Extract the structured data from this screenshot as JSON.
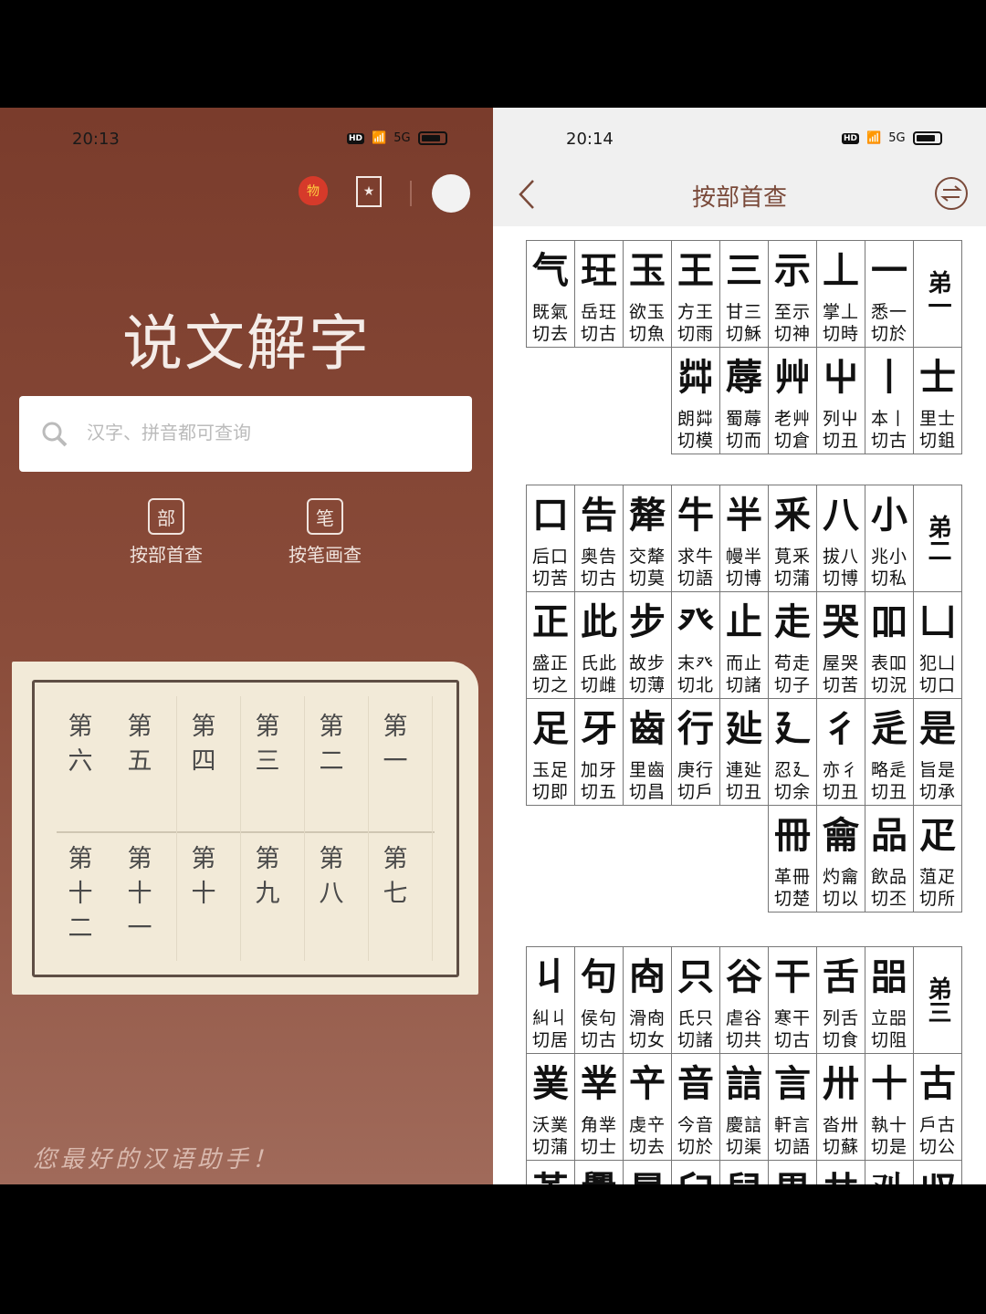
{
  "left": {
    "status_time": "20:13",
    "status_icons": [
      "hd-icon",
      "wifi-icon",
      "5g-signal-icon",
      "battery-icon"
    ],
    "gift_badge": "物",
    "app_title": "说文解字",
    "search_placeholder": "汉字、拼音都可查询",
    "modes": [
      {
        "icon": "部",
        "label": "按部首查"
      },
      {
        "icon": "笔",
        "label": "按笔画查"
      }
    ],
    "chapters_row1": [
      "第一",
      "第二",
      "第三",
      "第四",
      "第五",
      "第六"
    ],
    "chapters_row2": [
      "第七",
      "第八",
      "第九",
      "第十",
      "第十一",
      "第十二"
    ],
    "slogan": "您最好的汉语助手！",
    "colors": {
      "background": "#7a3c2c",
      "scroll": "#f2ead8"
    }
  },
  "right": {
    "status_time": "20:14",
    "title": "按部首查",
    "sections": [
      {
        "label": "弟一",
        "cells": [
          {
            "seal": "一",
            "note": [
              "悉一",
              "切於"
            ]
          },
          {
            "seal": "丄",
            "note": [
              "掌丄",
              "切時"
            ]
          },
          {
            "seal": "示",
            "note": [
              "至示",
              "切神"
            ]
          },
          {
            "seal": "三",
            "note": [
              "甘三",
              "切穌"
            ]
          },
          {
            "seal": "王",
            "note": [
              "方王",
              "切雨"
            ]
          },
          {
            "seal": "玉",
            "note": [
              "欲玉",
              "切魚"
            ]
          },
          {
            "seal": "玨",
            "note": [
              "岳玨",
              "切古"
            ]
          },
          {
            "seal": "气",
            "note": [
              "既氣",
              "切去"
            ]
          },
          {
            "seal": "士",
            "note": [
              "里士",
              "切鉏"
            ]
          },
          {
            "seal": "丨",
            "note": [
              "本丨",
              "切古"
            ]
          },
          {
            "seal": "屮",
            "note": [
              "列屮",
              "切丑"
            ]
          },
          {
            "seal": "艸",
            "note": [
              "老艸",
              "切倉"
            ]
          },
          {
            "seal": "蓐",
            "note": [
              "蜀蓐",
              "切而"
            ]
          },
          {
            "seal": "茻",
            "note": [
              "朗茻",
              "切模"
            ]
          }
        ]
      },
      {
        "label": "弟二",
        "cells": [
          {
            "seal": "小",
            "note": [
              "兆小",
              "切私"
            ]
          },
          {
            "seal": "八",
            "note": [
              "拔八",
              "切博"
            ]
          },
          {
            "seal": "釆",
            "note": [
              "莧釆",
              "切蒲"
            ]
          },
          {
            "seal": "半",
            "note": [
              "幔半",
              "切博"
            ]
          },
          {
            "seal": "牛",
            "note": [
              "求牛",
              "切語"
            ]
          },
          {
            "seal": "犛",
            "note": [
              "交犛",
              "切莫"
            ]
          },
          {
            "seal": "告",
            "note": [
              "奥告",
              "切古"
            ]
          },
          {
            "seal": "口",
            "note": [
              "后口",
              "切苦"
            ]
          },
          {
            "seal": "凵",
            "note": [
              "犯凵",
              "切口"
            ]
          },
          {
            "seal": "吅",
            "note": [
              "表吅",
              "切況"
            ]
          },
          {
            "seal": "哭",
            "note": [
              "屋哭",
              "切苦"
            ]
          },
          {
            "seal": "走",
            "note": [
              "苟走",
              "切子"
            ]
          },
          {
            "seal": "止",
            "note": [
              "而止",
              "切諸"
            ]
          },
          {
            "seal": "癶",
            "note": [
              "末癶",
              "切北"
            ]
          },
          {
            "seal": "步",
            "note": [
              "故步",
              "切薄"
            ]
          },
          {
            "seal": "此",
            "note": [
              "氏此",
              "切雌"
            ]
          },
          {
            "seal": "正",
            "note": [
              "盛正",
              "切之"
            ]
          },
          {
            "seal": "是",
            "note": [
              "旨是",
              "切承"
            ]
          },
          {
            "seal": "辵",
            "note": [
              "略辵",
              "切丑"
            ]
          },
          {
            "seal": "彳",
            "note": [
              "亦彳",
              "切丑"
            ]
          },
          {
            "seal": "廴",
            "note": [
              "忍廴",
              "切余"
            ]
          },
          {
            "seal": "㢟",
            "note": [
              "連㢟",
              "切丑"
            ]
          },
          {
            "seal": "行",
            "note": [
              "庚行",
              "切戶"
            ]
          },
          {
            "seal": "齒",
            "note": [
              "里齒",
              "切昌"
            ]
          },
          {
            "seal": "牙",
            "note": [
              "加牙",
              "切五"
            ]
          },
          {
            "seal": "足",
            "note": [
              "玉足",
              "切即"
            ]
          },
          {
            "seal": "疋",
            "note": [
              "菹疋",
              "切所"
            ]
          },
          {
            "seal": "品",
            "note": [
              "飲品",
              "切丕"
            ]
          },
          {
            "seal": "龠",
            "note": [
              "灼龠",
              "切以"
            ]
          },
          {
            "seal": "冊",
            "note": [
              "革冊",
              "切楚"
            ]
          }
        ]
      },
      {
        "label": "弟三",
        "cells": [
          {
            "seal": "㗊",
            "note": [
              "立㗊",
              "切阻"
            ]
          },
          {
            "seal": "舌",
            "note": [
              "列舌",
              "切食"
            ]
          },
          {
            "seal": "干",
            "note": [
              "寒干",
              "切古"
            ]
          },
          {
            "seal": "谷",
            "note": [
              "虐谷",
              "切共"
            ]
          },
          {
            "seal": "只",
            "note": [
              "氏只",
              "切諸"
            ]
          },
          {
            "seal": "㕯",
            "note": [
              "滑㕯",
              "切女"
            ]
          },
          {
            "seal": "句",
            "note": [
              "侯句",
              "切古"
            ]
          },
          {
            "seal": "丩",
            "note": [
              "糾丩",
              "切居"
            ]
          },
          {
            "seal": "古",
            "note": [
              "戶古",
              "切公"
            ]
          },
          {
            "seal": "十",
            "note": [
              "執十",
              "切是"
            ]
          },
          {
            "seal": "卅",
            "note": [
              "沓卅",
              "切蘇"
            ]
          },
          {
            "seal": "言",
            "note": [
              "軒言",
              "切語"
            ]
          },
          {
            "seal": "誩",
            "note": [
              "慶誩",
              "切渠"
            ]
          },
          {
            "seal": "音",
            "note": [
              "今音",
              "切於"
            ]
          },
          {
            "seal": "䇂",
            "note": [
              "虔䇂",
              "切去"
            ]
          },
          {
            "seal": "丵",
            "note": [
              "角丵",
              "切士"
            ]
          },
          {
            "seal": "菐",
            "note": [
              "沃菐",
              "切蒲"
            ]
          },
          {
            "seal": "𠬞",
            "note": [
              "",
              ""
            ]
          },
          {
            "seal": "𠬜",
            "note": [
              "",
              ""
            ]
          },
          {
            "seal": "共",
            "note": [
              "",
              ""
            ]
          },
          {
            "seal": "異",
            "note": [
              "",
              ""
            ]
          },
          {
            "seal": "舁",
            "note": [
              "",
              ""
            ]
          },
          {
            "seal": "臼",
            "note": [
              "",
              ""
            ]
          },
          {
            "seal": "晨",
            "note": [
              "",
              ""
            ]
          },
          {
            "seal": "爨",
            "note": [
              "",
              ""
            ]
          },
          {
            "seal": "革",
            "note": [
              "",
              ""
            ]
          }
        ]
      }
    ]
  }
}
